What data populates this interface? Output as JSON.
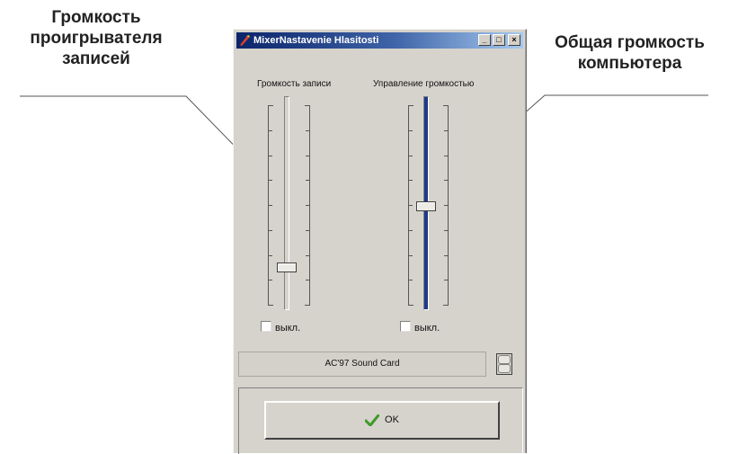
{
  "callouts": {
    "left": [
      "Громкость",
      "проигрывателя",
      "записей"
    ],
    "right": [
      "Общая громкость",
      "компьютера"
    ]
  },
  "window": {
    "title": "MixerNastavenie Hlasitosti",
    "controls": [
      "minimize-icon",
      "maximize-icon",
      "close-icon"
    ]
  },
  "sliders": {
    "record": {
      "label": "Громкость записи",
      "level": 0.15
    },
    "master": {
      "label": "Управление громкостью",
      "level": 0.47
    }
  },
  "mute": {
    "record_label": "выкл.",
    "master_label": "выкл."
  },
  "device": {
    "name": "AC'97 Sound Card"
  },
  "ok_button": {
    "label": "OK",
    "icon": "checkmark-icon"
  },
  "colors": {
    "titlebar_start": "#0a246a",
    "titlebar_end": "#a6caf0",
    "check": "#3f9a2a",
    "master_track": "#1f3a8a"
  }
}
